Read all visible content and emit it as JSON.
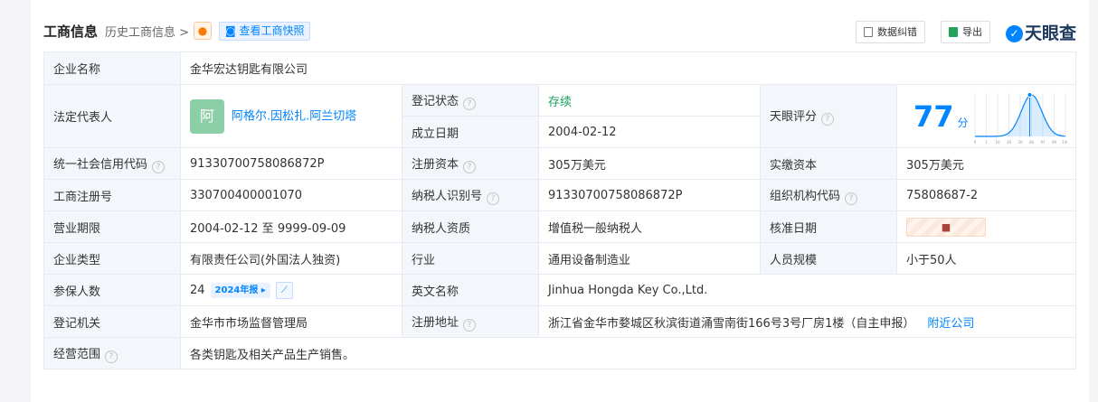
{
  "header": {
    "title": "工商信息",
    "history": "历史工商信息 >",
    "snapshot": "查看工商快照",
    "correct": "数据纠错",
    "export": "导出",
    "logo": "天眼查"
  },
  "rows": {
    "company_name": {
      "label": "企业名称",
      "value": "金华宏达钥匙有限公司"
    },
    "legal_rep": {
      "label": "法定代表人",
      "avatar": "阿",
      "value": "阿格尔.因松扎.阿兰切塔"
    },
    "reg_status": {
      "label": "登记状态",
      "value": "存续"
    },
    "est_date": {
      "label": "成立日期",
      "value": "2004-02-12"
    },
    "score": {
      "label": "天眼评分",
      "value": "77",
      "unit": "分"
    },
    "credit_code": {
      "label": "统一社会信用代码",
      "value": "91330700758086872P"
    },
    "reg_capital": {
      "label": "注册资本",
      "value": "305万美元"
    },
    "paid_capital": {
      "label": "实缴资本",
      "value": "305万美元"
    },
    "reg_no": {
      "label": "工商注册号",
      "value": "330700400001070"
    },
    "tax_id": {
      "label": "纳税人识别号",
      "value": "91330700758086872P"
    },
    "org_code": {
      "label": "组织机构代码",
      "value": "75808687-2"
    },
    "term": {
      "label": "营业期限",
      "value": "2004-02-12 至 9999-09-09"
    },
    "taxpayer_type": {
      "label": "纳税人资质",
      "value": "增值税一般纳税人"
    },
    "approve_date": {
      "label": "核准日期"
    },
    "company_type": {
      "label": "企业类型",
      "value": "有限责任公司(外国法人独资)"
    },
    "industry": {
      "label": "行业",
      "value": "通用设备制造业"
    },
    "staff_size": {
      "label": "人员规模",
      "value": "小于50人"
    },
    "insured": {
      "label": "参保人数",
      "value": "24",
      "badge": "2024年报"
    },
    "english_name": {
      "label": "英文名称",
      "value": "Jinhua Hongda Key Co.,Ltd."
    },
    "reg_authority": {
      "label": "登记机关",
      "value": "金华市市场监督管理局"
    },
    "reg_address": {
      "label": "注册地址",
      "value": "浙江省金华市婺城区秋滨街道涌雪南街166号3号厂房1楼（自主申报）",
      "link": "附近公司"
    },
    "scope": {
      "label": "经营范围",
      "value": "各类钥匙及相关产品生产销售。"
    }
  },
  "score_chart": {
    "ticks": [
      "0",
      "1",
      "10",
      "30",
      "50",
      "80",
      "97",
      "99",
      "100"
    ],
    "marker_value": "77",
    "accent": "#0084ff"
  },
  "colors": {
    "accent": "#0084ff",
    "status_green": "#19a15f"
  }
}
